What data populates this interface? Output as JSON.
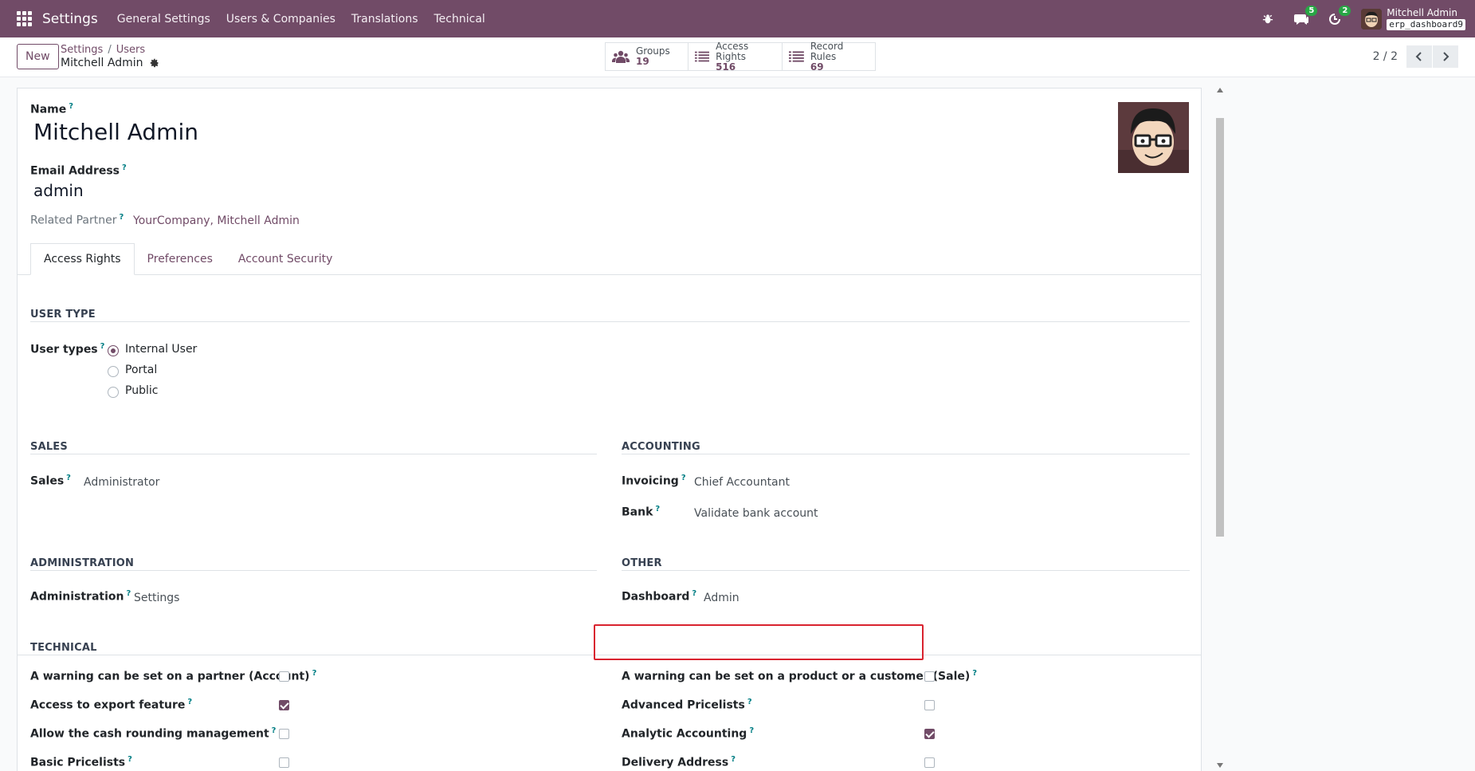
{
  "navbar": {
    "brand": "Settings",
    "menu": [
      "General Settings",
      "Users & Companies",
      "Translations",
      "Technical"
    ],
    "chat_badge": "5",
    "activity_badge": "2",
    "user_name": "Mitchell Admin",
    "db_name": "erp_dashboard9"
  },
  "control": {
    "new_label": "New",
    "breadcrumb_settings": "Settings",
    "breadcrumb_sep": "/",
    "breadcrumb_users": "Users",
    "record_title": "Mitchell Admin",
    "smart_buttons": [
      {
        "label": "Groups",
        "value": "19"
      },
      {
        "label": "Access Rights",
        "value": "516"
      },
      {
        "label": "Record Rules",
        "value": "69"
      }
    ],
    "pager": "2 / 2"
  },
  "form": {
    "name_label": "Name",
    "name_value": "Mitchell Admin",
    "email_label": "Email Address",
    "email_value": "admin",
    "partner_label": "Related Partner",
    "partner_value": "YourCompany, Mitchell Admin",
    "help_mark": "?",
    "tabs": [
      "Access Rights",
      "Preferences",
      "Account Security"
    ],
    "user_type_section": "USER TYPE",
    "user_types_label": "User types",
    "user_types": [
      "Internal User",
      "Portal",
      "Public"
    ],
    "sales_section": "SALES",
    "sales_label": "Sales",
    "sales_value": "Administrator",
    "accounting_section": "ACCOUNTING",
    "invoicing_label": "Invoicing",
    "invoicing_value": "Chief Accountant",
    "bank_label": "Bank",
    "bank_value": "Validate bank account",
    "administration_section": "ADMINISTRATION",
    "administration_label": "Administration",
    "administration_value": "Settings",
    "other_section": "OTHER",
    "dashboard_label": "Dashboard",
    "dashboard_value": "Admin",
    "technical_section": "TECHNICAL",
    "technical_left": [
      {
        "label": "A warning can be set on a partner (Account)",
        "checked": false
      },
      {
        "label": "Access to export feature",
        "checked": true
      },
      {
        "label": "Allow the cash rounding management",
        "checked": false
      },
      {
        "label": "Basic Pricelists",
        "checked": false
      }
    ],
    "technical_right": [
      {
        "label": "A warning can be set on a product or a customer (Sale)",
        "checked": false
      },
      {
        "label": "Advanced Pricelists",
        "checked": false
      },
      {
        "label": "Analytic Accounting",
        "checked": true
      },
      {
        "label": "Delivery Address",
        "checked": false
      }
    ]
  },
  "colors": {
    "brand": "#714B67",
    "highlight": "#d9232f",
    "badge": "#28a745"
  }
}
